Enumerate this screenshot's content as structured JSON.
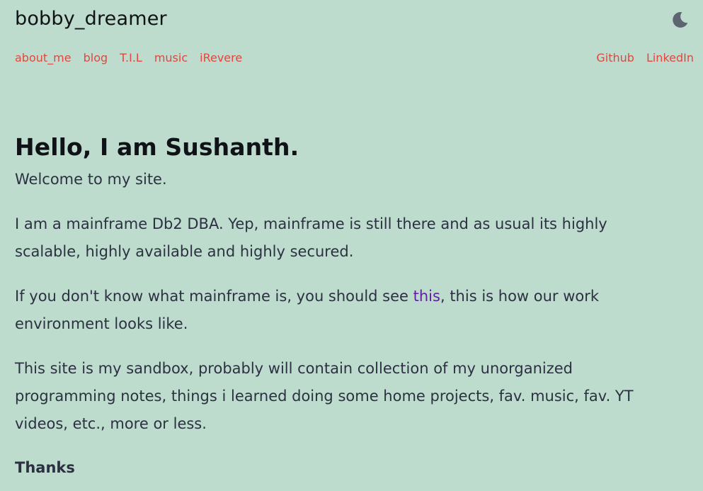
{
  "header": {
    "brand": "bobby_dreamer",
    "theme_icon": "moon-icon",
    "nav_left": [
      "about_me",
      "blog",
      "T.I.L",
      "music",
      "iRevere"
    ],
    "nav_right": [
      "Github",
      "LinkedIn"
    ]
  },
  "main": {
    "title": "Hello, I am Sushanth.",
    "welcome": "Welcome to my site.",
    "para1": "I am a mainframe Db2 DBA. Yep, mainframe is still there and as usual its highly scalable, highly available and highly secured.",
    "para2_before": "If you don't know what mainframe is, you should see ",
    "para2_link": "this",
    "para2_after": ", this is how our work environment looks like.",
    "para3": "This site is my sandbox, probably will contain collection of my unorganized programming notes, things i learned doing some home projects, fav. music, fav. YT videos, etc., more or less.",
    "thanks": "Thanks"
  },
  "colors": {
    "background": "#bedcce",
    "nav_link": "#e0473f",
    "inline_link": "#5f1fa0",
    "text": "#2b3140"
  }
}
